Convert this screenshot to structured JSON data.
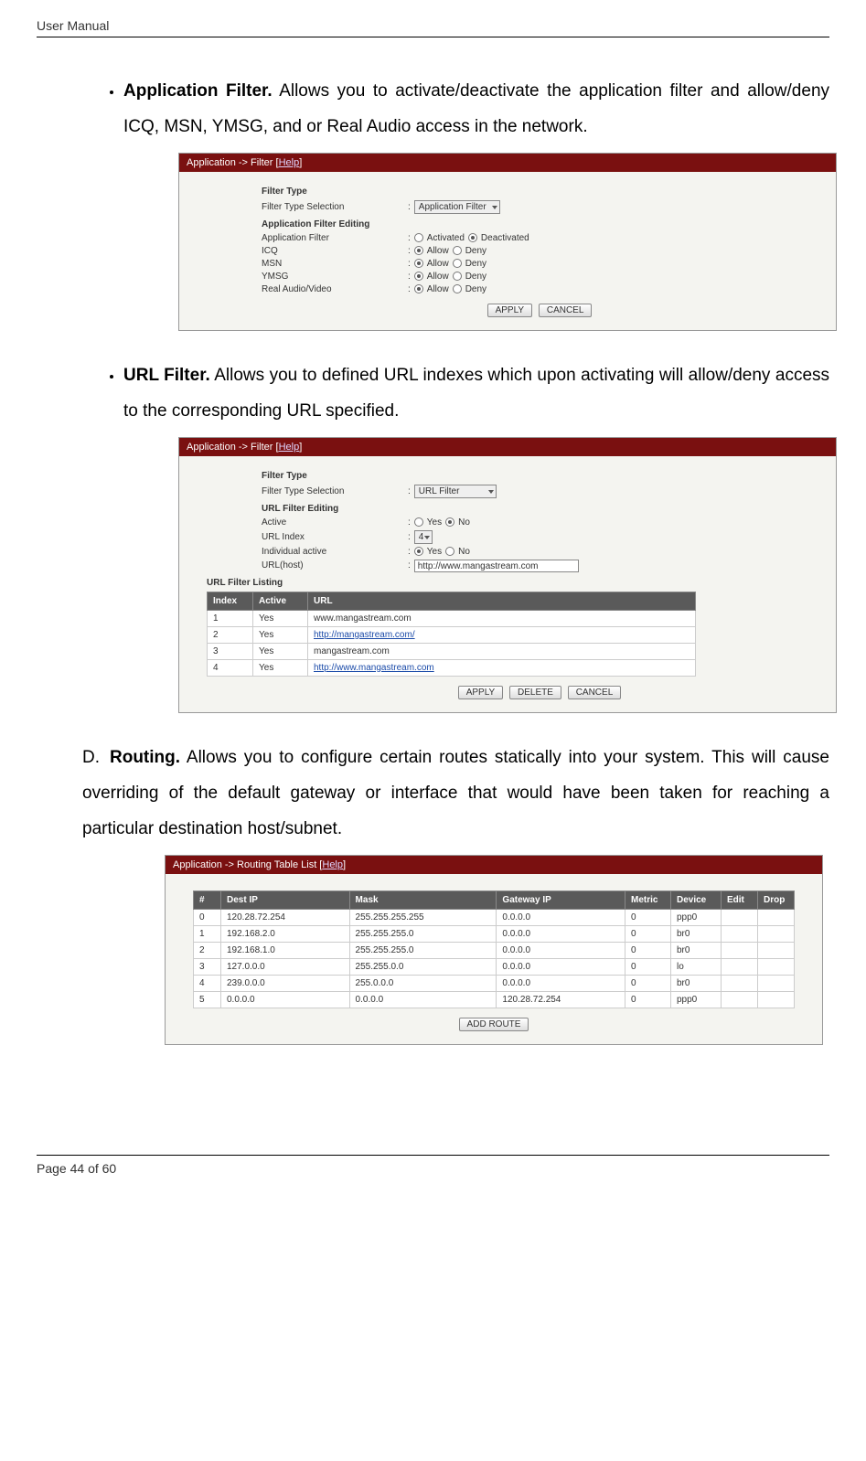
{
  "header": {
    "title": "User Manual"
  },
  "footer": {
    "left": "Page 44",
    "right": "of 60"
  },
  "appFilter": {
    "bulletTitle": "Application Filter.",
    "bulletBody": " Allows you to activate/deactivate the application filter and allow/deny ICQ, MSN, YMSG, and or Real Audio access in the network.",
    "bar": {
      "prefix": "Application -> Filter [",
      "help": "Help",
      "suffix": "]"
    },
    "heads": {
      "ft": "Filter Type",
      "afe": "Application Filter Editing"
    },
    "labels": {
      "fts": "Filter Type Selection",
      "af": "Application Filter",
      "icq": "ICQ",
      "msn": "MSN",
      "ymsg": "YMSG",
      "rav": "Real Audio/Video",
      "activated": "Activated",
      "deactivated": "Deactivated",
      "allow": "Allow",
      "deny": "Deny"
    },
    "select": "Application Filter",
    "buttons": {
      "apply": "APPLY",
      "cancel": "CANCEL"
    }
  },
  "urlFilter": {
    "bulletTitle": "URL Filter.",
    "bulletBody": " Allows you to defined URL indexes which upon activating will allow/deny access to the corresponding URL specified.",
    "bar": {
      "prefix": "Application -> Filter [",
      "help": "Help",
      "suffix": "]"
    },
    "heads": {
      "ft": "Filter Type",
      "ufe": "URL Filter Editing",
      "ufl": "URL Filter Listing"
    },
    "labels": {
      "fts": "Filter Type Selection",
      "active": "Active",
      "urlIndex": "URL Index",
      "indiv": "Individual active",
      "urlHost": "URL(host)",
      "yes": "Yes",
      "no": "No"
    },
    "selectFts": "URL Filter",
    "selectIdx": "4",
    "urlValue": "http://www.mangastream.com",
    "cols": {
      "index": "Index",
      "active": "Active",
      "url": "URL"
    },
    "rows": [
      {
        "index": "1",
        "active": "Yes",
        "url": "www.mangastream.com",
        "link": false
      },
      {
        "index": "2",
        "active": "Yes",
        "url": "http://mangastream.com/",
        "link": true
      },
      {
        "index": "3",
        "active": "Yes",
        "url": "mangastream.com",
        "link": false
      },
      {
        "index": "4",
        "active": "Yes",
        "url": "http://www.mangastream.com",
        "link": true
      }
    ],
    "buttons": {
      "apply": "APPLY",
      "delete": "DELETE",
      "cancel": "CANCEL"
    }
  },
  "routing": {
    "letter": "D.",
    "title": "Routing.",
    "body": " Allows you to configure certain routes statically into your system. This will cause overriding of the default gateway or interface that would have been taken for reaching a particular destination host/subnet.",
    "bar": {
      "prefix": "Application -> Routing Table List [",
      "help": "Help",
      "suffix": "]"
    },
    "cols": {
      "num": "#",
      "dest": "Dest IP",
      "mask": "Mask",
      "gw": "Gateway IP",
      "metric": "Metric",
      "dev": "Device",
      "edit": "Edit",
      "drop": "Drop"
    },
    "rows": [
      {
        "num": "0",
        "dest": "120.28.72.254",
        "mask": "255.255.255.255",
        "gw": "0.0.0.0",
        "metric": "0",
        "dev": "ppp0"
      },
      {
        "num": "1",
        "dest": "192.168.2.0",
        "mask": "255.255.255.0",
        "gw": "0.0.0.0",
        "metric": "0",
        "dev": "br0"
      },
      {
        "num": "2",
        "dest": "192.168.1.0",
        "mask": "255.255.255.0",
        "gw": "0.0.0.0",
        "metric": "0",
        "dev": "br0"
      },
      {
        "num": "3",
        "dest": "127.0.0.0",
        "mask": "255.255.0.0",
        "gw": "0.0.0.0",
        "metric": "0",
        "dev": "lo"
      },
      {
        "num": "4",
        "dest": "239.0.0.0",
        "mask": "255.0.0.0",
        "gw": "0.0.0.0",
        "metric": "0",
        "dev": "br0"
      },
      {
        "num": "5",
        "dest": "0.0.0.0",
        "mask": "0.0.0.0",
        "gw": "120.28.72.254",
        "metric": "0",
        "dev": "ppp0"
      }
    ],
    "buttons": {
      "add": "ADD ROUTE"
    }
  }
}
